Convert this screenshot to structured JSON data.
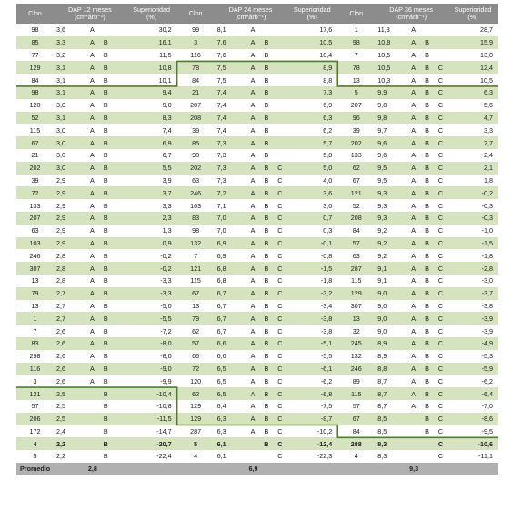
{
  "table": {
    "header": {
      "clon": "Clon",
      "dap12": "DAP 12 meses",
      "dap24": "DAP 24 meses",
      "dap36": "DAP 36 meses",
      "unit": "(cm*árb⁻¹)",
      "sup": "Superioridad",
      "sup_unit": "(%)"
    },
    "rows": [
      [
        [
          "98",
          "3,6",
          "A",
          "",
          "",
          "30,2"
        ],
        [
          "99",
          "8,1",
          "A",
          "",
          "",
          "17,6"
        ],
        [
          "1",
          "11,3",
          "A",
          "",
          "",
          "28,7"
        ]
      ],
      [
        [
          "85",
          "3,3",
          "A",
          "B",
          "",
          "16,1"
        ],
        [
          "3",
          "7,6",
          "A",
          "B",
          "",
          "10,5"
        ],
        [
          "98",
          "10,8",
          "A",
          "B",
          "",
          "15,9"
        ]
      ],
      [
        [
          "77",
          "3,2",
          "A",
          "B",
          "",
          "11,5"
        ],
        [
          "116",
          "7,6",
          "A",
          "B",
          "",
          "10,4"
        ],
        [
          "7",
          "10,5",
          "A",
          "B",
          "",
          "13,0"
        ]
      ],
      [
        [
          "129",
          "3,1",
          "A",
          "B",
          "",
          "10,8"
        ],
        [
          "78",
          "7,5",
          "A",
          "B",
          "",
          "8,9"
        ],
        [
          "78",
          "10,5",
          "A",
          "B",
          "C",
          "12,4"
        ]
      ],
      [
        [
          "84",
          "3,1",
          "A",
          "B",
          "",
          "10,1"
        ],
        [
          "84",
          "7,5",
          "A",
          "B",
          "",
          "8,8"
        ],
        [
          "13",
          "10,3",
          "A",
          "B",
          "C",
          "10,5"
        ]
      ],
      [
        [
          "98",
          "3,1",
          "A",
          "B",
          "",
          "9,4"
        ],
        [
          "21",
          "7,4",
          "A",
          "B",
          "",
          "7,3"
        ],
        [
          "5",
          "9,9",
          "A",
          "B",
          "C",
          "6,3"
        ]
      ],
      [
        [
          "120",
          "3,0",
          "A",
          "B",
          "",
          "9,0"
        ],
        [
          "207",
          "7,4",
          "A",
          "B",
          "",
          "6,9"
        ],
        [
          "207",
          "9,8",
          "A",
          "B",
          "C",
          "5,6"
        ]
      ],
      [
        [
          "52",
          "3,1",
          "A",
          "B",
          "",
          "8,3"
        ],
        [
          "208",
          "7,4",
          "A",
          "B",
          "",
          "6,3"
        ],
        [
          "96",
          "9,8",
          "A",
          "B",
          "C",
          "4,7"
        ]
      ],
      [
        [
          "115",
          "3,0",
          "A",
          "B",
          "",
          "7,4"
        ],
        [
          "39",
          "7,4",
          "A",
          "B",
          "",
          "6,2"
        ],
        [
          "39",
          "9,7",
          "A",
          "B",
          "C",
          "3,3"
        ]
      ],
      [
        [
          "67",
          "3,0",
          "A",
          "B",
          "",
          "6,9"
        ],
        [
          "85",
          "7,3",
          "A",
          "B",
          "",
          "5,7"
        ],
        [
          "202",
          "9,6",
          "A",
          "B",
          "C",
          "2,7"
        ]
      ],
      [
        [
          "21",
          "3,0",
          "A",
          "B",
          "",
          "6,7"
        ],
        [
          "98",
          "7,3",
          "A",
          "B",
          "",
          "5,8"
        ],
        [
          "133",
          "9,6",
          "A",
          "B",
          "C",
          "2,4"
        ]
      ],
      [
        [
          "202",
          "3,0",
          "A",
          "B",
          "",
          "5,5"
        ],
        [
          "202",
          "7,3",
          "A",
          "B",
          "C",
          "5,0"
        ],
        [
          "62",
          "9,5",
          "A",
          "B",
          "C",
          "2,1"
        ]
      ],
      [
        [
          "39",
          "2,9",
          "A",
          "B",
          "",
          "3,9"
        ],
        [
          "63",
          "7,3",
          "A",
          "B",
          "C",
          "4,0"
        ],
        [
          "67",
          "9,5",
          "A",
          "B",
          "C",
          "1,8"
        ]
      ],
      [
        [
          "72",
          "2,9",
          "A",
          "B",
          "",
          "3,7"
        ],
        [
          "246",
          "7,2",
          "A",
          "B",
          "C",
          "3,6"
        ],
        [
          "121",
          "9,3",
          "A",
          "B",
          "C",
          "-0,2"
        ]
      ],
      [
        [
          "133",
          "2,9",
          "A",
          "B",
          "",
          "3,3"
        ],
        [
          "103",
          "7,1",
          "A",
          "B",
          "C",
          "3,0"
        ],
        [
          "52",
          "9,3",
          "A",
          "B",
          "C",
          "-0,3"
        ]
      ],
      [
        [
          "207",
          "2,9",
          "A",
          "B",
          "",
          "2,3"
        ],
        [
          "83",
          "7,0",
          "A",
          "B",
          "C",
          "0,7"
        ],
        [
          "208",
          "9,3",
          "A",
          "B",
          "C",
          "-0,3"
        ]
      ],
      [
        [
          "63",
          "2,9",
          "A",
          "B",
          "",
          "1,3"
        ],
        [
          "98",
          "7,0",
          "A",
          "B",
          "C",
          "0,3"
        ],
        [
          "84",
          "9,2",
          "A",
          "B",
          "C",
          "-1,0"
        ]
      ],
      [
        [
          "103",
          "2,9",
          "A",
          "B",
          "",
          "0,9"
        ],
        [
          "132",
          "6,9",
          "A",
          "B",
          "C",
          "-0,1"
        ],
        [
          "57",
          "9,2",
          "A",
          "B",
          "C",
          "-1,5"
        ]
      ],
      [
        [
          "246",
          "2,8",
          "A",
          "B",
          "",
          "-0,2"
        ],
        [
          "7",
          "6,9",
          "A",
          "B",
          "C",
          "-0,8"
        ],
        [
          "63",
          "9,2",
          "A",
          "B",
          "C",
          "-1,8"
        ]
      ],
      [
        [
          "307",
          "2,8",
          "A",
          "B",
          "",
          "-0,2"
        ],
        [
          "121",
          "6,8",
          "A",
          "B",
          "C",
          "-1,5"
        ],
        [
          "287",
          "9,1",
          "A",
          "B",
          "C",
          "-2,8"
        ]
      ],
      [
        [
          "13",
          "2,8",
          "A",
          "B",
          "",
          "-3,3"
        ],
        [
          "115",
          "6,8",
          "A",
          "B",
          "C",
          "-1,8"
        ],
        [
          "115",
          "9,1",
          "A",
          "B",
          "C",
          "-3,0"
        ]
      ],
      [
        [
          "79",
          "2,7",
          "A",
          "B",
          "",
          "-3,3"
        ],
        [
          "67",
          "6,7",
          "A",
          "B",
          "C",
          "-3,2"
        ],
        [
          "129",
          "9,0",
          "A",
          "B",
          "C",
          "-3,7"
        ]
      ],
      [
        [
          "13",
          "2,7",
          "A",
          "B",
          "",
          "-5,0"
        ],
        [
          "13",
          "6,7",
          "A",
          "B",
          "C",
          "-3,4"
        ],
        [
          "307",
          "9,0",
          "A",
          "B",
          "C",
          "-3,8"
        ]
      ],
      [
        [
          "1",
          "2,7",
          "A",
          "B",
          "",
          "-5,5"
        ],
        [
          "79",
          "6,7",
          "A",
          "B",
          "C",
          "-3,8"
        ],
        [
          "13",
          "9,0",
          "A",
          "B",
          "C",
          "-3,9"
        ]
      ],
      [
        [
          "7",
          "2,6",
          "A",
          "B",
          "",
          "-7,2"
        ],
        [
          "62",
          "6,7",
          "A",
          "B",
          "C",
          "-3,8"
        ],
        [
          "32",
          "9,0",
          "A",
          "B",
          "C",
          "-3,9"
        ]
      ],
      [
        [
          "83",
          "2,6",
          "A",
          "B",
          "",
          "-8,0"
        ],
        [
          "57",
          "6,6",
          "A",
          "B",
          "C",
          "-5,1"
        ],
        [
          "245",
          "8,9",
          "A",
          "B",
          "C",
          "-4,9"
        ]
      ],
      [
        [
          "298",
          "2,6",
          "A",
          "B",
          "",
          "-8,0"
        ],
        [
          "66",
          "6,6",
          "A",
          "B",
          "C",
          "-5,5"
        ],
        [
          "132",
          "8,9",
          "A",
          "B",
          "C",
          "-5,3"
        ]
      ],
      [
        [
          "116",
          "2,6",
          "A",
          "B",
          "",
          "-9,0"
        ],
        [
          "72",
          "6,5",
          "A",
          "B",
          "C",
          "-6,1"
        ],
        [
          "246",
          "8,8",
          "A",
          "B",
          "C",
          "-5,9"
        ]
      ],
      [
        [
          "3",
          "2,6",
          "A",
          "B",
          "",
          "-9,9"
        ],
        [
          "120",
          "6,5",
          "A",
          "B",
          "C",
          "-6,2"
        ],
        [
          "89",
          "8,7",
          "A",
          "B",
          "C",
          "-6,2"
        ]
      ],
      [
        [
          "121",
          "2,5",
          "",
          "B",
          "",
          "-10,4"
        ],
        [
          "62",
          "6,5",
          "A",
          "B",
          "C",
          "-6,8"
        ],
        [
          "115",
          "8,7",
          "A",
          "B",
          "C",
          "-6,4"
        ]
      ],
      [
        [
          "57",
          "2,5",
          "",
          "B",
          "",
          "-10,8"
        ],
        [
          "129",
          "6,4",
          "A",
          "B",
          "C",
          "-7,5"
        ],
        [
          "57",
          "8,7",
          "A",
          "B",
          "C",
          "-7,0"
        ]
      ],
      [
        [
          "206",
          "2,5",
          "",
          "B",
          "",
          "-11,5"
        ],
        [
          "129",
          "6,3",
          "A",
          "B",
          "C",
          "-8,7"
        ],
        [
          "67",
          "8,5",
          "",
          "B",
          "C",
          "-8,6"
        ]
      ],
      [
        [
          "172",
          "2,4",
          "",
          "B",
          "",
          "-14,7"
        ],
        [
          "287",
          "6,3",
          "A",
          "B",
          "C",
          "-10,2"
        ],
        [
          "84",
          "8,5",
          "",
          "B",
          "C",
          "-9,5"
        ]
      ],
      [
        [
          "4",
          "2,2",
          "",
          "B",
          "",
          "-20,7"
        ],
        [
          "5",
          "6,1",
          "",
          "B",
          "C",
          "-12,4"
        ],
        [
          "288",
          "8,3",
          "",
          "",
          "C",
          "-10,6"
        ]
      ],
      [
        [
          "5",
          "2,2",
          "",
          "B",
          "",
          "-22,4"
        ],
        [
          "4",
          "6,1",
          "",
          "",
          "C",
          "-22,3"
        ],
        [
          "4",
          "8,3",
          "",
          "",
          "C",
          "-11,1"
        ]
      ]
    ],
    "footer": {
      "label": "Promedio",
      "dap12": "2,8",
      "dap24": "6,9",
      "dap36": "9,3"
    },
    "colors": {
      "header_bg": "#8c8c8c",
      "stripe": "#d6e3bf",
      "boundary_line": "#4f7f2a",
      "footer_bg": "#b0b0b0"
    }
  }
}
